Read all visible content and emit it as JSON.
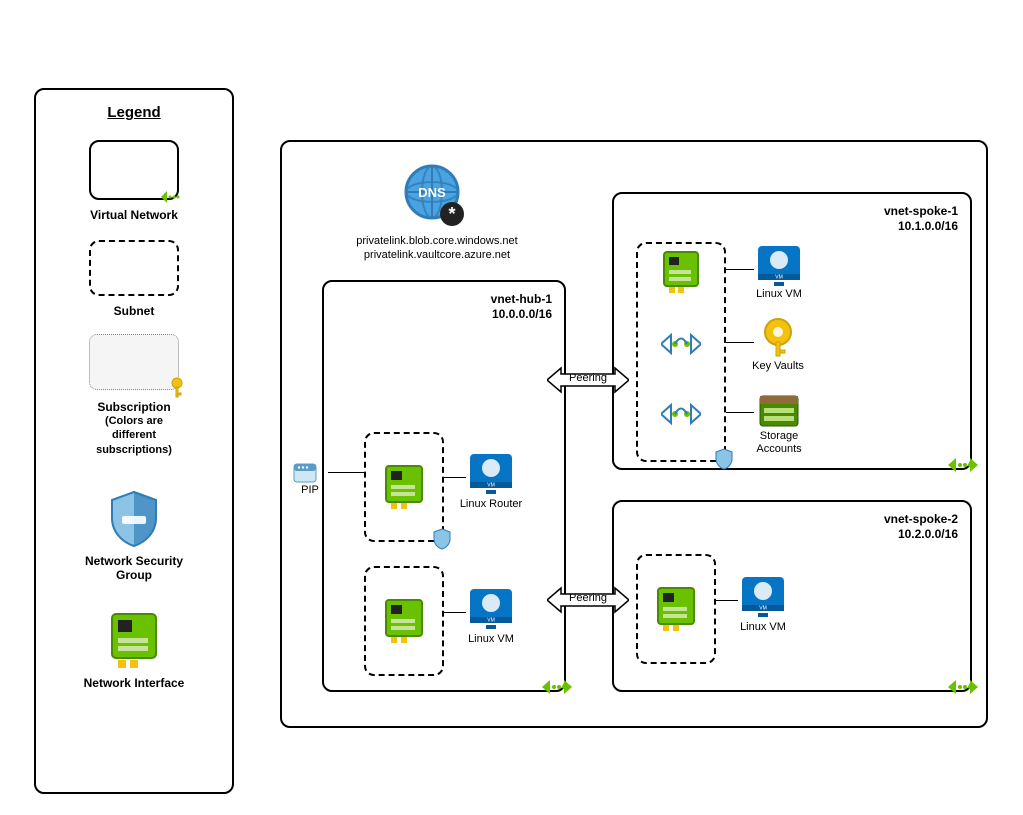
{
  "legend": {
    "title": "Legend",
    "virtual_network": "Virtual Network",
    "subnet": "Subnet",
    "subscription": "Subscription",
    "subscription_note": "(Colors are\ndifferent\nsubscriptions)",
    "nsg": "Network Security\nGroup",
    "nic": "Network Interface"
  },
  "dns": {
    "line1": "privatelink.blob.core.windows.net",
    "line2": "privatelink.vaultcore.azure.net"
  },
  "hub": {
    "name": "vnet-hub-1",
    "cidr": "10.0.0.0/16",
    "pip_label": "PIP",
    "router_label": "Linux Router",
    "vm_label": "Linux VM"
  },
  "spoke1": {
    "name": "vnet-spoke-1",
    "cidr": "10.1.0.0/16",
    "vm_label": "Linux VM",
    "kv_label": "Key Vaults",
    "storage_label": "Storage\nAccounts"
  },
  "spoke2": {
    "name": "vnet-spoke-2",
    "cidr": "10.2.0.0/16",
    "vm_label": "Linux VM"
  },
  "peering": {
    "label1": "Peering",
    "label2": "Peering"
  }
}
